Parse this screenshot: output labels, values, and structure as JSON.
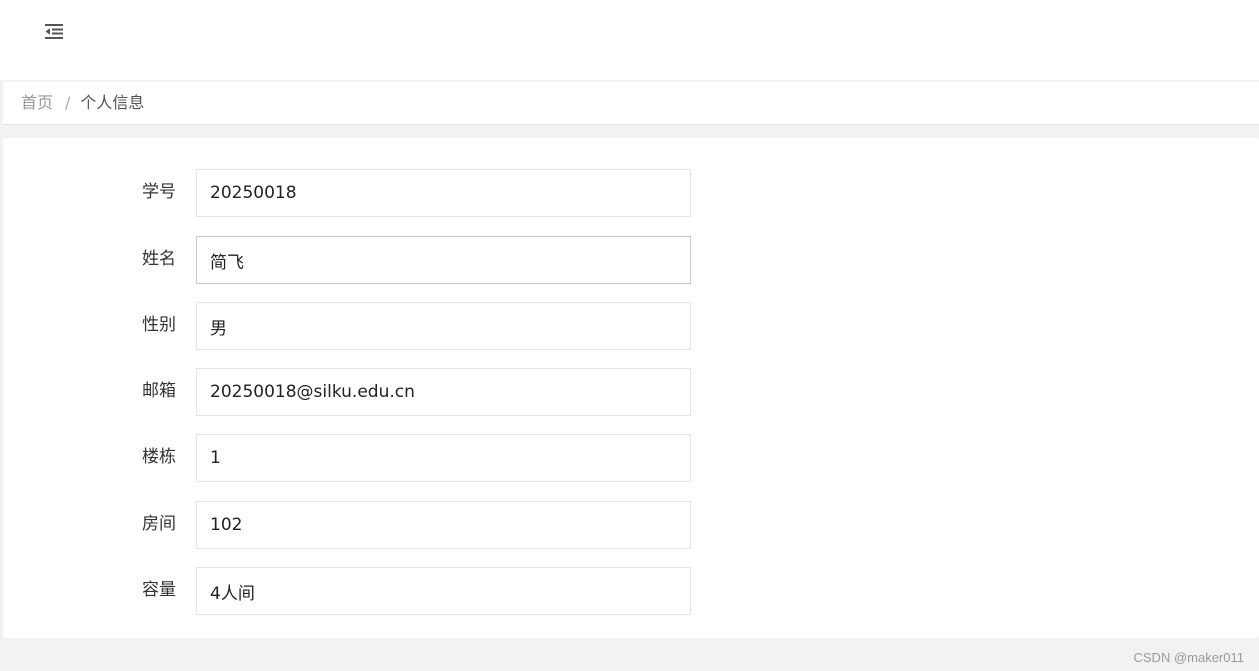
{
  "header": {
    "menu_icon": "menu-fold-icon"
  },
  "breadcrumb": {
    "home": "首页",
    "separator": "/",
    "current": "个人信息"
  },
  "form": {
    "fields": [
      {
        "label": "学号",
        "value": "20250018"
      },
      {
        "label": "姓名",
        "value": "简飞"
      },
      {
        "label": "性别",
        "value": "男"
      },
      {
        "label": "邮箱",
        "value": "20250018@silku.edu.cn"
      },
      {
        "label": "楼栋",
        "value": "1"
      },
      {
        "label": "房间",
        "value": "102"
      },
      {
        "label": "容量",
        "value": "4人间"
      }
    ]
  },
  "watermark": "CSDN @maker011"
}
